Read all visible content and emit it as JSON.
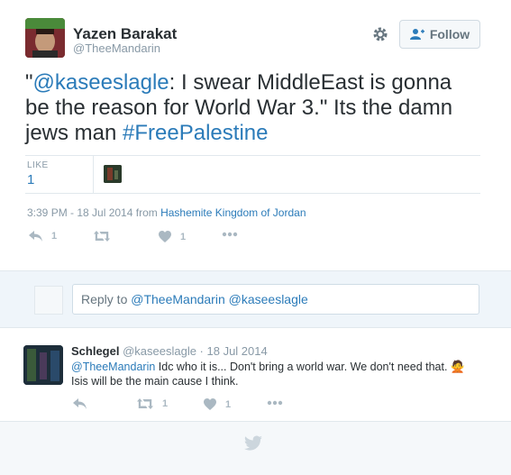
{
  "author": {
    "name": "Yazen Barakat",
    "handle": "@TheeMandarin"
  },
  "header": {
    "follow_label": "Follow"
  },
  "tweet": {
    "text_prefix": "\"",
    "mention": "@kaseeslagle",
    "text_body": ": I swear MiddleEast is gonna be the reason for World War 3.\" Its the damn jews man ",
    "hashtag": "#FreePalestine",
    "likes_label": "LIKE",
    "likes_count": "1",
    "timestamp": "3:39 PM - 18 Jul 2014 from ",
    "place": "Hashemite Kingdom of Jordan",
    "actions": {
      "reply_count": "1",
      "like_count": "1"
    }
  },
  "reply_box": {
    "prefix": "Reply to ",
    "mentions": "@TheeMandarin @kaseeslagle"
  },
  "reply": {
    "name": "Schlegel",
    "meta": "@kaseeslagle · 18 Jul 2014",
    "mention": "@TheeMandarin",
    "text": " Idc who it is... Don't bring a world war. We don't need that. ",
    "text2": "Isis will be the main cause I think.",
    "retweet_count": "1",
    "like_count": "1"
  },
  "icons": {
    "gear": "gear-icon",
    "follow": "person-add-icon",
    "reply": "reply-icon",
    "retweet": "retweet-icon",
    "like": "heart-icon",
    "more": "more-icon",
    "emoji": "person-gesturing-no-emoji",
    "bird": "twitter-bird-icon"
  },
  "colors": {
    "link": "#2b7bb9",
    "muted": "#8899a6",
    "reply_bg": "#eff5fa"
  }
}
